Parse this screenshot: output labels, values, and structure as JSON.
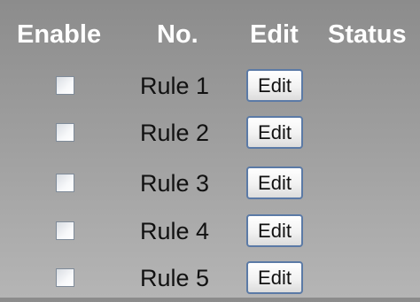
{
  "table": {
    "headers": {
      "enable": "Enable",
      "no": "No.",
      "edit": "Edit",
      "status": "Status"
    },
    "rows": [
      {
        "label": "Rule 1",
        "edit_label": "Edit",
        "enabled": false,
        "status": ""
      },
      {
        "label": "Rule 2",
        "edit_label": "Edit",
        "enabled": false,
        "status": ""
      },
      {
        "label": "Rule 3",
        "edit_label": "Edit",
        "enabled": false,
        "status": ""
      },
      {
        "label": "Rule 4",
        "edit_label": "Edit",
        "enabled": false,
        "status": ""
      },
      {
        "label": "Rule 5",
        "edit_label": "Edit",
        "enabled": false,
        "status": ""
      }
    ]
  },
  "colors": {
    "header_text": "#ffffff",
    "button_border": "#5b7aa6",
    "background": "#9e9e9e"
  }
}
